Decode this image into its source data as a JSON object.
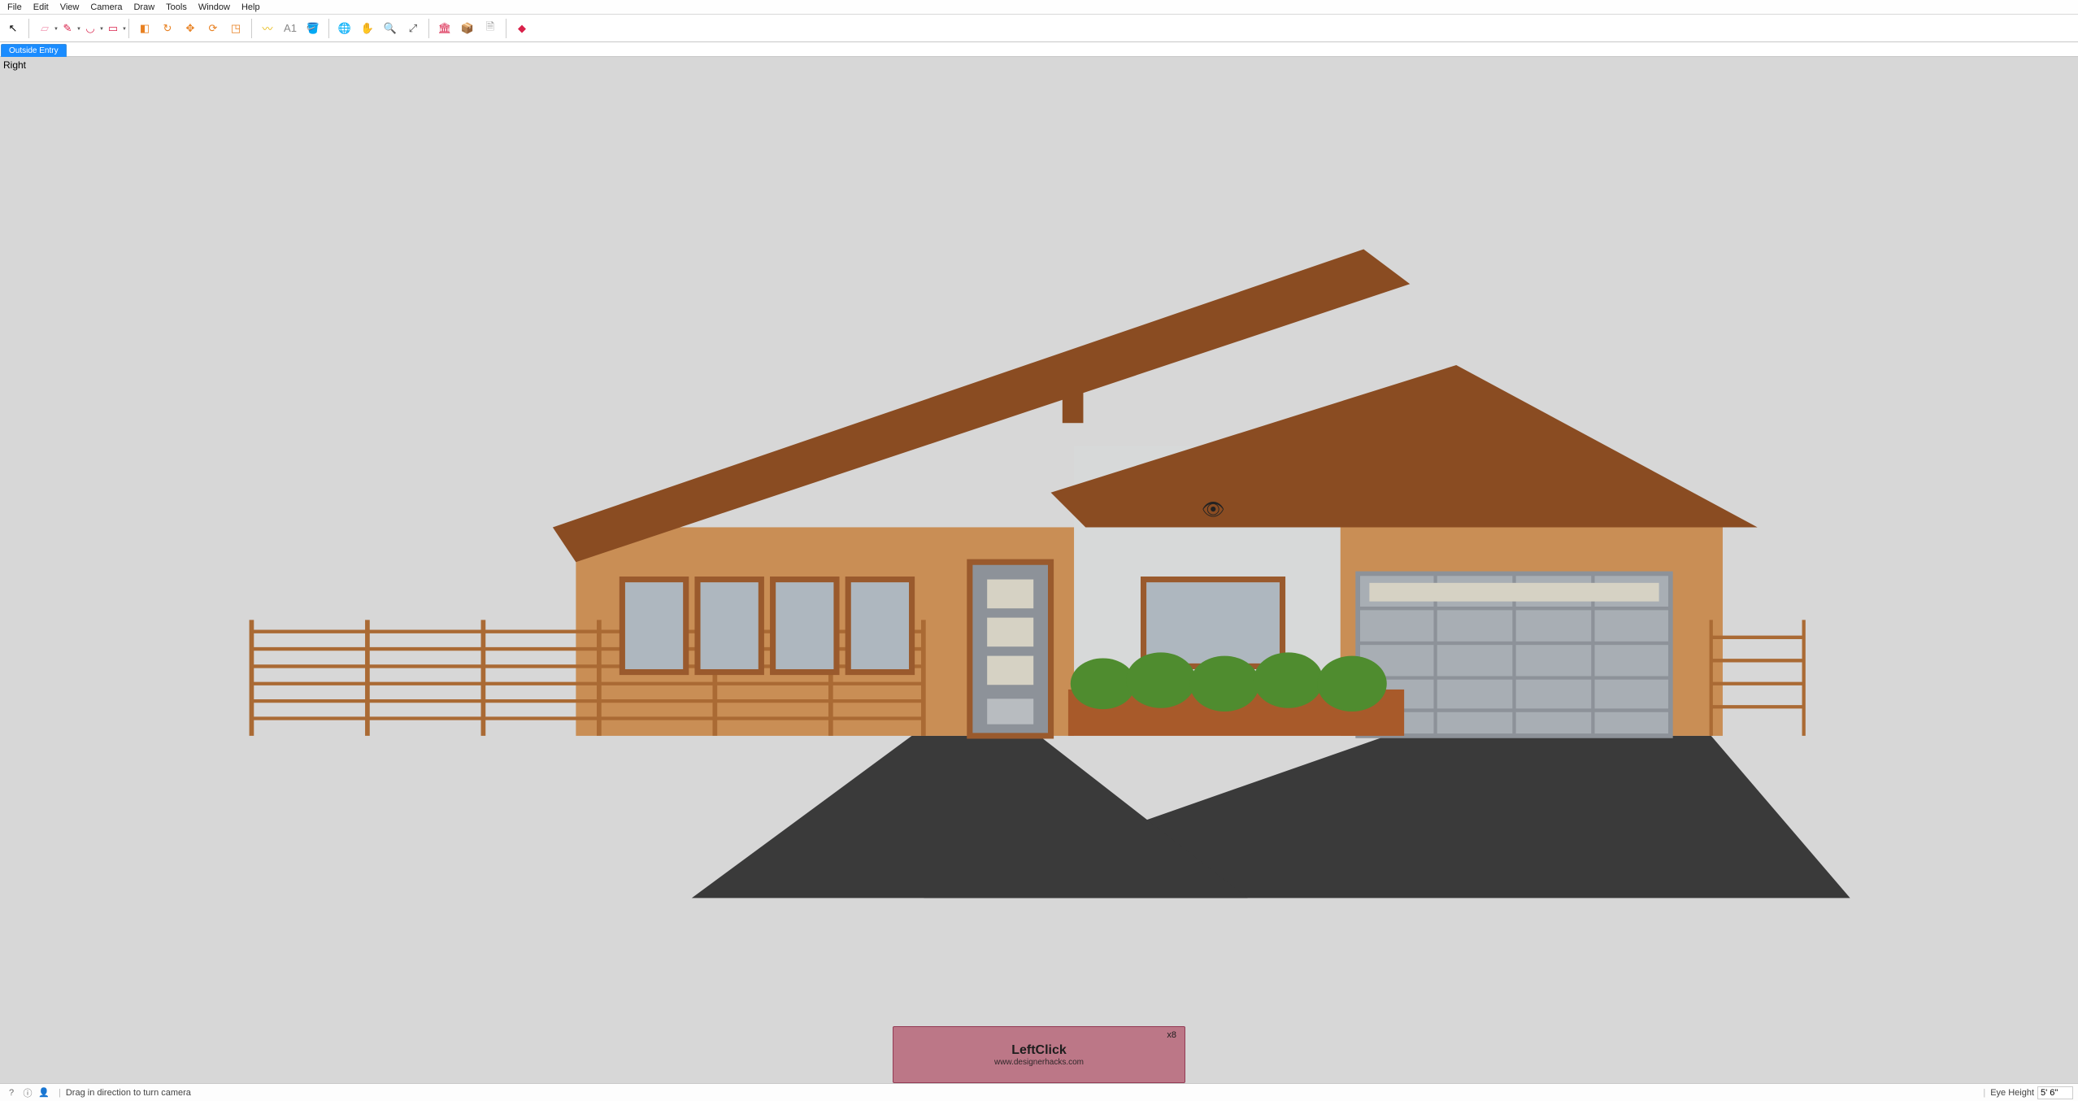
{
  "menu": {
    "items": [
      "File",
      "Edit",
      "View",
      "Camera",
      "Draw",
      "Tools",
      "Window",
      "Help"
    ]
  },
  "toolbar": [
    {
      "name": "select-tool",
      "glyph": "↖",
      "color": "#000",
      "drop": false
    },
    {
      "name": "sep"
    },
    {
      "name": "eraser-tool",
      "glyph": "▱",
      "color": "#f29ab5",
      "drop": true
    },
    {
      "name": "pencil-tool",
      "glyph": "✎",
      "color": "#d9214a",
      "drop": true
    },
    {
      "name": "arc-tool",
      "glyph": "◡",
      "color": "#d9214a",
      "drop": true
    },
    {
      "name": "rect-tool",
      "glyph": "▭",
      "color": "#d9214a",
      "drop": true
    },
    {
      "name": "sep"
    },
    {
      "name": "push-pull-tool",
      "glyph": "◧",
      "color": "#e88122",
      "drop": false
    },
    {
      "name": "offset-tool",
      "glyph": "↻",
      "color": "#e88122",
      "drop": false
    },
    {
      "name": "move-tool",
      "glyph": "✥",
      "color": "#e88122",
      "drop": false
    },
    {
      "name": "rotate-tool",
      "glyph": "⟳",
      "color": "#e88122",
      "drop": false
    },
    {
      "name": "scale-tool",
      "glyph": "◳",
      "color": "#e88122",
      "drop": false
    },
    {
      "name": "sep"
    },
    {
      "name": "tape-measure-tool",
      "glyph": "〰",
      "color": "#e6b500",
      "drop": false
    },
    {
      "name": "text-tool",
      "glyph": "A1",
      "color": "#888",
      "drop": false
    },
    {
      "name": "paint-bucket-tool",
      "glyph": "🪣",
      "color": "#e6b500",
      "drop": false
    },
    {
      "name": "sep"
    },
    {
      "name": "orbit-tool",
      "glyph": "🌐",
      "color": "#1a8cff",
      "drop": false
    },
    {
      "name": "pan-tool",
      "glyph": "✋",
      "color": "#e6b500",
      "drop": false
    },
    {
      "name": "zoom-tool",
      "glyph": "🔍",
      "color": "#444",
      "drop": false
    },
    {
      "name": "zoom-extents-tool",
      "glyph": "⤢",
      "color": "#444",
      "drop": false
    },
    {
      "name": "sep"
    },
    {
      "name": "3d-warehouse",
      "glyph": "🏛",
      "color": "#d9214a",
      "drop": false
    },
    {
      "name": "extension-warehouse",
      "glyph": "📦",
      "color": "#d9214a",
      "drop": false
    },
    {
      "name": "layout-tool",
      "glyph": "🗎",
      "color": "#999",
      "drop": false
    },
    {
      "name": "sep"
    },
    {
      "name": "ruby-console",
      "glyph": "◆",
      "color": "#d9214a",
      "drop": false
    }
  ],
  "scene_tab": {
    "label": "Outside Entry",
    "active": true
  },
  "viewport": {
    "label": "Right"
  },
  "overlay": {
    "count": "x8",
    "action": "LeftClick",
    "url": "www.designerhacks.com"
  },
  "status": {
    "hint": "Drag in direction to turn camera",
    "vcb_label": "Eye Height",
    "vcb_value": "5' 6\""
  }
}
